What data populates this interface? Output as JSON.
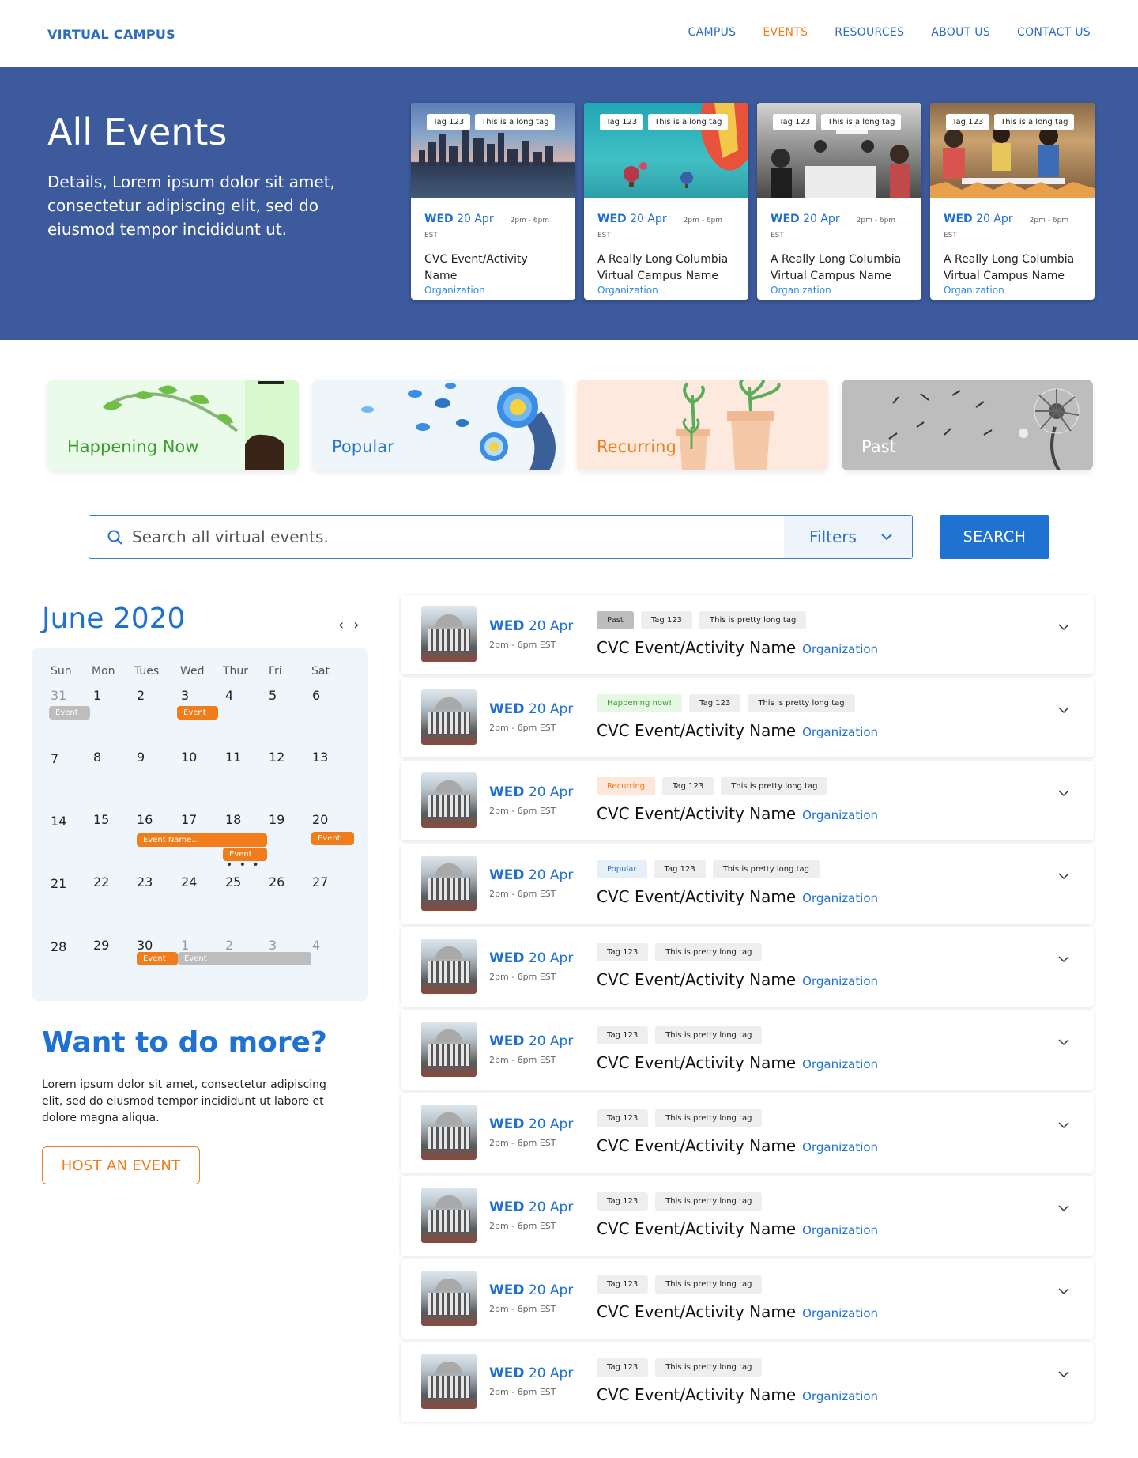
{
  "header": {
    "logo": "VIRTUAL CAMPUS",
    "nav": [
      "CAMPUS",
      "EVENTS",
      "RESOURCES",
      "ABOUT US",
      "CONTACT US"
    ],
    "active_nav": "EVENTS"
  },
  "hero": {
    "title": "All Events",
    "description": "Details, Lorem ipsum dolor sit amet, consectetur adipiscing elit, sed do eiusmod tempor incididunt ut.",
    "cards": [
      {
        "tag1": "Tag 123",
        "tag2": "This is a long tag",
        "weekday": "WED",
        "date": "20 Apr",
        "time": "2pm - 6pm EST",
        "name": "CVC Event/Activity Name",
        "org": "Organization"
      },
      {
        "tag1": "Tag 123",
        "tag2": "This is a long tag",
        "weekday": "WED",
        "date": "20 Apr",
        "time": "2pm - 6pm EST",
        "name": "A Really Long Columbia Virtual Campus Name",
        "org": "Organization"
      },
      {
        "tag1": "Tag 123",
        "tag2": "This is a long tag",
        "weekday": "WED",
        "date": "20 Apr",
        "time": "2pm - 6pm EST",
        "name": "A Really Long Columbia Virtual Campus Name",
        "org": "Organization"
      },
      {
        "tag1": "Tag 123",
        "tag2": "This is a long tag",
        "weekday": "WED",
        "date": "20 Apr",
        "time": "2pm - 6pm EST",
        "name": "A Really Long Columbia Virtual Campus Name",
        "org": "Organization"
      }
    ]
  },
  "categories": {
    "now": "Happening Now",
    "popular": "Popular",
    "recurring": "Recurring",
    "past": "Past"
  },
  "search": {
    "placeholder": "Search all virtual events.",
    "filters_label": "Filters",
    "button_label": "SEARCH"
  },
  "calendar": {
    "title": "June 2020",
    "prev": "‹",
    "next": "›",
    "weekdays": [
      "Sun",
      "Mon",
      "Tues",
      "Wed",
      "Thur",
      "Fri",
      "Sat"
    ],
    "weeks": [
      [
        "31",
        "1",
        "2",
        "3",
        "4",
        "5",
        "6"
      ],
      [
        "7",
        "8",
        "9",
        "10",
        "11",
        "12",
        "13"
      ],
      [
        "14",
        "15",
        "16",
        "17",
        "18",
        "19",
        "20"
      ],
      [
        "21",
        "22",
        "23",
        "24",
        "25",
        "26",
        "27"
      ],
      [
        "28",
        "29",
        "30",
        "1",
        "2",
        "3",
        "4"
      ]
    ],
    "events": {
      "e31": "Event",
      "e3": "Event",
      "e16": "Event Name...",
      "e18": "Event",
      "e20": "Event",
      "e30": "Event",
      "e1": "Event",
      "more": "• • •"
    }
  },
  "more": {
    "title": "Want to do more?",
    "text": "Lorem ipsum dolor sit amet, consectetur adipiscing elit, sed do eiusmod tempor incididunt ut labore et dolore magna aliqua.",
    "button": "HOST AN EVENT"
  },
  "events": [
    {
      "weekday": "WED",
      "date": "20 Apr",
      "time": "2pm - 6pm EST",
      "status": "Past",
      "status_type": "past",
      "tag1": "Tag 123",
      "tag2": "This is pretty long tag",
      "name": "CVC Event/Activity Name",
      "org": "Organization"
    },
    {
      "weekday": "WED",
      "date": "20 Apr",
      "time": "2pm - 6pm EST",
      "status": "Happening now!",
      "status_type": "now",
      "tag1": "Tag 123",
      "tag2": "This is pretty long tag",
      "name": "CVC Event/Activity Name",
      "org": "Organization"
    },
    {
      "weekday": "WED",
      "date": "20 Apr",
      "time": "2pm - 6pm EST",
      "status": "Recurring",
      "status_type": "rec",
      "tag1": "Tag 123",
      "tag2": "This is pretty long tag",
      "name": "CVC Event/Activity Name",
      "org": "Organization"
    },
    {
      "weekday": "WED",
      "date": "20 Apr",
      "time": "2pm - 6pm EST",
      "status": "Popular",
      "status_type": "pop",
      "tag1": "Tag 123",
      "tag2": "This is pretty long tag",
      "name": "CVC Event/Activity Name",
      "org": "Organization"
    },
    {
      "weekday": "WED",
      "date": "20 Apr",
      "time": "2pm - 6pm EST",
      "status": "",
      "status_type": "",
      "tag1": "Tag 123",
      "tag2": "This is pretty long tag",
      "name": "CVC Event/Activity Name",
      "org": "Organization"
    },
    {
      "weekday": "WED",
      "date": "20 Apr",
      "time": "2pm - 6pm EST",
      "status": "",
      "status_type": "",
      "tag1": "Tag 123",
      "tag2": "This is pretty long tag",
      "name": "CVC Event/Activity Name",
      "org": "Organization"
    },
    {
      "weekday": "WED",
      "date": "20 Apr",
      "time": "2pm - 6pm EST",
      "status": "",
      "status_type": "",
      "tag1": "Tag 123",
      "tag2": "This is pretty long tag",
      "name": "CVC Event/Activity Name",
      "org": "Organization"
    },
    {
      "weekday": "WED",
      "date": "20 Apr",
      "time": "2pm - 6pm EST",
      "status": "",
      "status_type": "",
      "tag1": "Tag 123",
      "tag2": "This is pretty long tag",
      "name": "CVC Event/Activity Name",
      "org": "Organization"
    },
    {
      "weekday": "WED",
      "date": "20 Apr",
      "time": "2pm - 6pm EST",
      "status": "",
      "status_type": "",
      "tag1": "Tag 123",
      "tag2": "This is pretty long tag",
      "name": "CVC Event/Activity Name",
      "org": "Organization"
    },
    {
      "weekday": "WED",
      "date": "20 Apr",
      "time": "2pm - 6pm EST",
      "status": "",
      "status_type": "",
      "tag1": "Tag 123",
      "tag2": "This is pretty long tag",
      "name": "CVC Event/Activity Name",
      "org": "Organization"
    }
  ],
  "colors": {
    "brand_blue": "#1f72d1",
    "hero_bg": "#3d5a9c",
    "accent_orange": "#f07d1a",
    "now_green": "#3a9c2e"
  }
}
